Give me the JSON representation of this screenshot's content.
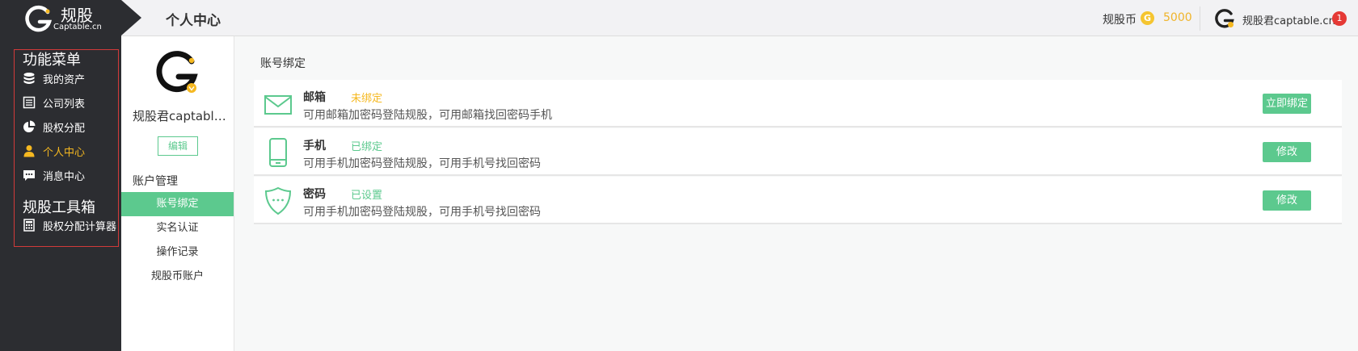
{
  "brand": {
    "name": "规股",
    "sub": "Captable.cn"
  },
  "header": {
    "title": "个人中心",
    "coin_label": "规股币",
    "coin_icon_text": "G",
    "coin_value": "5000",
    "user_name": "规股君captable.cn",
    "notif_count": "1"
  },
  "sidebar": {
    "menu_heading": "功能菜单",
    "items": [
      {
        "label": "我的资产",
        "icon": "database-icon"
      },
      {
        "label": "公司列表",
        "icon": "list-icon"
      },
      {
        "label": "股权分配",
        "icon": "pie-chart-icon"
      },
      {
        "label": "个人中心",
        "icon": "user-icon",
        "active": true
      },
      {
        "label": "消息中心",
        "icon": "message-icon"
      }
    ],
    "tools_heading": "规股工具箱",
    "tools": [
      {
        "label": "股权分配计算器",
        "icon": "calculator-icon"
      }
    ]
  },
  "subnav": {
    "profile_name": "规股君captable.cn",
    "edit_label": "编辑",
    "heading": "账户管理",
    "items": [
      {
        "label": "账号绑定",
        "active": true
      },
      {
        "label": "实名认证"
      },
      {
        "label": "操作记录"
      },
      {
        "label": "规股币账户"
      }
    ]
  },
  "main": {
    "title": "账号绑定",
    "bindings": [
      {
        "title": "邮箱",
        "status": "未绑定",
        "status_color": "#f5b820",
        "desc": "可用邮箱加密码登陆规股，可用邮箱找回密码手机",
        "button": "立即绑定",
        "icon": "mail-icon"
      },
      {
        "title": "手机",
        "status": "已绑定",
        "status_color": "#5cc98e",
        "desc": "可用手机加密码登陆规股，可用手机号找回密码",
        "button": "修改",
        "icon": "phone-icon"
      },
      {
        "title": "密码",
        "status": "已设置",
        "status_color": "#5cc98e",
        "desc": "可用手机加密码登陆规股，可用手机号找回密码",
        "button": "修改",
        "icon": "shield-icon"
      }
    ]
  },
  "colors": {
    "accent": "#5cc98e",
    "warning": "#f5b820",
    "sidebar_bg": "#2c2d31",
    "alert": "#e53935"
  }
}
